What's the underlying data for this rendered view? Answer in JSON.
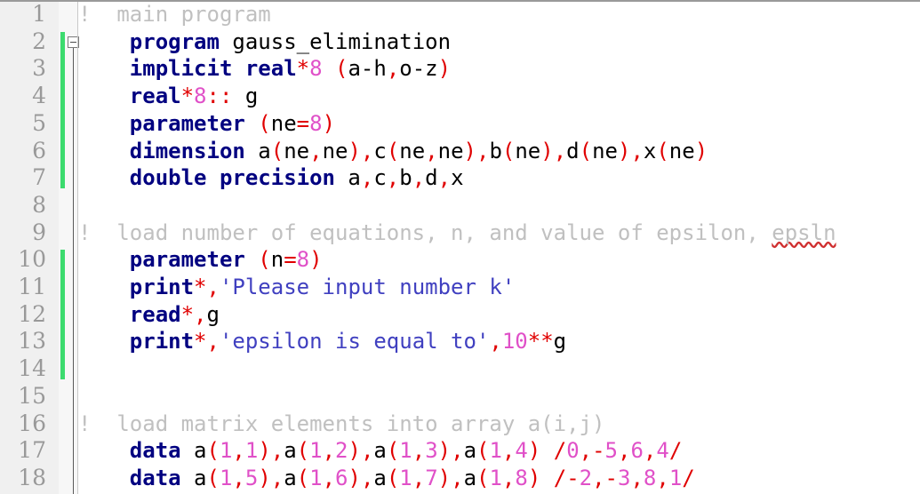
{
  "editor": {
    "language": "Fortran",
    "first_visible_line": 1,
    "last_visible_line": 18,
    "colors": {
      "background": "#ffffff",
      "gutter_background": "#f0f0f0",
      "line_number": "#999999",
      "keyword": "#000080",
      "identifier": "#000000",
      "punctuation": "#e00000",
      "number": "#e050c8",
      "string": "#4040c0",
      "comment": "#c0c0c0",
      "change_bar": "#3cdb6e",
      "spellcheck_underline": "#d03030"
    }
  },
  "gutter": {
    "fold_marker": "collapse-minus",
    "fold_marker_line": 2,
    "change_bars": [
      {
        "from_line": 2,
        "to_line": 7
      },
      {
        "from_line": 10,
        "to_line": 14
      }
    ],
    "line_numbers": [
      "1",
      "2",
      "3",
      "4",
      "5",
      "6",
      "7",
      "8",
      "9",
      "10",
      "11",
      "12",
      "13",
      "14",
      "15",
      "16",
      "17",
      "18"
    ]
  },
  "lines": [
    {
      "number": "1",
      "text": "!  main program",
      "tokens": [
        {
          "t": "!  main program",
          "c": "comment"
        }
      ]
    },
    {
      "number": "2",
      "text": "    program gauss_elimination",
      "tokens": [
        {
          "t": "    ",
          "c": "ident"
        },
        {
          "t": "program",
          "c": "kw"
        },
        {
          "t": " gauss_elimination",
          "c": "ident"
        }
      ]
    },
    {
      "number": "3",
      "text": "    implicit real*8 (a-h,o-z)",
      "tokens": [
        {
          "t": "    ",
          "c": "ident"
        },
        {
          "t": "implicit real",
          "c": "kw"
        },
        {
          "t": "*",
          "c": "punct"
        },
        {
          "t": "8",
          "c": "num"
        },
        {
          "t": " ",
          "c": "ident"
        },
        {
          "t": "(",
          "c": "punct"
        },
        {
          "t": "a-h",
          "c": "ident"
        },
        {
          "t": ",",
          "c": "punct"
        },
        {
          "t": "o-z",
          "c": "ident"
        },
        {
          "t": ")",
          "c": "punct"
        }
      ]
    },
    {
      "number": "4",
      "text": "    real*8:: g",
      "tokens": [
        {
          "t": "    ",
          "c": "ident"
        },
        {
          "t": "real",
          "c": "kw"
        },
        {
          "t": "*",
          "c": "punct"
        },
        {
          "t": "8",
          "c": "num"
        },
        {
          "t": "::",
          "c": "punct"
        },
        {
          "t": " g",
          "c": "ident"
        }
      ]
    },
    {
      "number": "5",
      "text": "    parameter (ne=8)",
      "tokens": [
        {
          "t": "    ",
          "c": "ident"
        },
        {
          "t": "parameter",
          "c": "kw"
        },
        {
          "t": " ",
          "c": "ident"
        },
        {
          "t": "(",
          "c": "punct"
        },
        {
          "t": "ne",
          "c": "ident"
        },
        {
          "t": "=",
          "c": "punct"
        },
        {
          "t": "8",
          "c": "num"
        },
        {
          "t": ")",
          "c": "punct"
        }
      ]
    },
    {
      "number": "6",
      "text": "    dimension a(ne,ne),c(ne,ne),b(ne),d(ne),x(ne)",
      "tokens": [
        {
          "t": "    ",
          "c": "ident"
        },
        {
          "t": "dimension",
          "c": "kw"
        },
        {
          "t": " a",
          "c": "ident"
        },
        {
          "t": "(",
          "c": "punct"
        },
        {
          "t": "ne",
          "c": "ident"
        },
        {
          "t": ",",
          "c": "punct"
        },
        {
          "t": "ne",
          "c": "ident"
        },
        {
          "t": ")",
          "c": "punct"
        },
        {
          "t": ",",
          "c": "punct"
        },
        {
          "t": "c",
          "c": "ident"
        },
        {
          "t": "(",
          "c": "punct"
        },
        {
          "t": "ne",
          "c": "ident"
        },
        {
          "t": ",",
          "c": "punct"
        },
        {
          "t": "ne",
          "c": "ident"
        },
        {
          "t": ")",
          "c": "punct"
        },
        {
          "t": ",",
          "c": "punct"
        },
        {
          "t": "b",
          "c": "ident"
        },
        {
          "t": "(",
          "c": "punct"
        },
        {
          "t": "ne",
          "c": "ident"
        },
        {
          "t": ")",
          "c": "punct"
        },
        {
          "t": ",",
          "c": "punct"
        },
        {
          "t": "d",
          "c": "ident"
        },
        {
          "t": "(",
          "c": "punct"
        },
        {
          "t": "ne",
          "c": "ident"
        },
        {
          "t": ")",
          "c": "punct"
        },
        {
          "t": ",",
          "c": "punct"
        },
        {
          "t": "x",
          "c": "ident"
        },
        {
          "t": "(",
          "c": "punct"
        },
        {
          "t": "ne",
          "c": "ident"
        },
        {
          "t": ")",
          "c": "punct"
        }
      ]
    },
    {
      "number": "7",
      "text": "    double precision a,c,b,d,x",
      "tokens": [
        {
          "t": "    ",
          "c": "ident"
        },
        {
          "t": "double precision",
          "c": "kw"
        },
        {
          "t": " a",
          "c": "ident"
        },
        {
          "t": ",",
          "c": "punct"
        },
        {
          "t": "c",
          "c": "ident"
        },
        {
          "t": ",",
          "c": "punct"
        },
        {
          "t": "b",
          "c": "ident"
        },
        {
          "t": ",",
          "c": "punct"
        },
        {
          "t": "d",
          "c": "ident"
        },
        {
          "t": ",",
          "c": "punct"
        },
        {
          "t": "x",
          "c": "ident"
        }
      ]
    },
    {
      "number": "8",
      "text": "",
      "tokens": []
    },
    {
      "number": "9",
      "text": "!  load number of equations, n, and value of epsilon, epsln",
      "tokens": [
        {
          "t": "!  load number of equations, n, and value of epsilon, ",
          "c": "comment"
        },
        {
          "t": "epsln",
          "c": "misspell"
        }
      ]
    },
    {
      "number": "10",
      "text": "    parameter (n=8)",
      "tokens": [
        {
          "t": "    ",
          "c": "ident"
        },
        {
          "t": "parameter",
          "c": "kw"
        },
        {
          "t": " ",
          "c": "ident"
        },
        {
          "t": "(",
          "c": "punct"
        },
        {
          "t": "n",
          "c": "ident"
        },
        {
          "t": "=",
          "c": "punct"
        },
        {
          "t": "8",
          "c": "num"
        },
        {
          "t": ")",
          "c": "punct"
        }
      ]
    },
    {
      "number": "11",
      "text": "    print*,'Please input number k'",
      "tokens": [
        {
          "t": "    ",
          "c": "ident"
        },
        {
          "t": "print",
          "c": "kw"
        },
        {
          "t": "*",
          "c": "punct"
        },
        {
          "t": ",",
          "c": "punct"
        },
        {
          "t": "'Please input number k'",
          "c": "str"
        }
      ]
    },
    {
      "number": "12",
      "text": "    read*,g",
      "tokens": [
        {
          "t": "    ",
          "c": "ident"
        },
        {
          "t": "read",
          "c": "kw"
        },
        {
          "t": "*",
          "c": "punct"
        },
        {
          "t": ",",
          "c": "punct"
        },
        {
          "t": "g",
          "c": "ident"
        }
      ]
    },
    {
      "number": "13",
      "text": "    print*,'epsilon is equal to',10**g",
      "tokens": [
        {
          "t": "    ",
          "c": "ident"
        },
        {
          "t": "print",
          "c": "kw"
        },
        {
          "t": "*",
          "c": "punct"
        },
        {
          "t": ",",
          "c": "punct"
        },
        {
          "t": "'epsilon is equal to'",
          "c": "str"
        },
        {
          "t": ",",
          "c": "punct"
        },
        {
          "t": "10",
          "c": "num"
        },
        {
          "t": "**",
          "c": "punct"
        },
        {
          "t": "g",
          "c": "ident"
        }
      ]
    },
    {
      "number": "14",
      "text": "",
      "tokens": []
    },
    {
      "number": "15",
      "text": "",
      "tokens": []
    },
    {
      "number": "16",
      "text": "!  load matrix elements into array a(i,j)",
      "tokens": [
        {
          "t": "!  load matrix elements into array a(i,j)",
          "c": "comment"
        }
      ]
    },
    {
      "number": "17",
      "text": "    data a(1,1),a(1,2),a(1,3),a(1,4) /0,-5,6,4/",
      "tokens": [
        {
          "t": "    ",
          "c": "ident"
        },
        {
          "t": "data",
          "c": "kw"
        },
        {
          "t": " a",
          "c": "ident"
        },
        {
          "t": "(",
          "c": "punct"
        },
        {
          "t": "1",
          "c": "num"
        },
        {
          "t": ",",
          "c": "punct"
        },
        {
          "t": "1",
          "c": "num"
        },
        {
          "t": ")",
          "c": "punct"
        },
        {
          "t": ",",
          "c": "punct"
        },
        {
          "t": "a",
          "c": "ident"
        },
        {
          "t": "(",
          "c": "punct"
        },
        {
          "t": "1",
          "c": "num"
        },
        {
          "t": ",",
          "c": "punct"
        },
        {
          "t": "2",
          "c": "num"
        },
        {
          "t": ")",
          "c": "punct"
        },
        {
          "t": ",",
          "c": "punct"
        },
        {
          "t": "a",
          "c": "ident"
        },
        {
          "t": "(",
          "c": "punct"
        },
        {
          "t": "1",
          "c": "num"
        },
        {
          "t": ",",
          "c": "punct"
        },
        {
          "t": "3",
          "c": "num"
        },
        {
          "t": ")",
          "c": "punct"
        },
        {
          "t": ",",
          "c": "punct"
        },
        {
          "t": "a",
          "c": "ident"
        },
        {
          "t": "(",
          "c": "punct"
        },
        {
          "t": "1",
          "c": "num"
        },
        {
          "t": ",",
          "c": "punct"
        },
        {
          "t": "4",
          "c": "num"
        },
        {
          "t": ")",
          "c": "punct"
        },
        {
          "t": " ",
          "c": "ident"
        },
        {
          "t": "/",
          "c": "punct"
        },
        {
          "t": "0",
          "c": "num"
        },
        {
          "t": ",",
          "c": "punct"
        },
        {
          "t": "-",
          "c": "punct"
        },
        {
          "t": "5",
          "c": "num"
        },
        {
          "t": ",",
          "c": "punct"
        },
        {
          "t": "6",
          "c": "num"
        },
        {
          "t": ",",
          "c": "punct"
        },
        {
          "t": "4",
          "c": "num"
        },
        {
          "t": "/",
          "c": "punct"
        }
      ]
    },
    {
      "number": "18",
      "text": "    data a(1,5),a(1,6),a(1,7),a(1,8) /-2,-3,8,1/",
      "tokens": [
        {
          "t": "    ",
          "c": "ident"
        },
        {
          "t": "data",
          "c": "kw"
        },
        {
          "t": " a",
          "c": "ident"
        },
        {
          "t": "(",
          "c": "punct"
        },
        {
          "t": "1",
          "c": "num"
        },
        {
          "t": ",",
          "c": "punct"
        },
        {
          "t": "5",
          "c": "num"
        },
        {
          "t": ")",
          "c": "punct"
        },
        {
          "t": ",",
          "c": "punct"
        },
        {
          "t": "a",
          "c": "ident"
        },
        {
          "t": "(",
          "c": "punct"
        },
        {
          "t": "1",
          "c": "num"
        },
        {
          "t": ",",
          "c": "punct"
        },
        {
          "t": "6",
          "c": "num"
        },
        {
          "t": ")",
          "c": "punct"
        },
        {
          "t": ",",
          "c": "punct"
        },
        {
          "t": "a",
          "c": "ident"
        },
        {
          "t": "(",
          "c": "punct"
        },
        {
          "t": "1",
          "c": "num"
        },
        {
          "t": ",",
          "c": "punct"
        },
        {
          "t": "7",
          "c": "num"
        },
        {
          "t": ")",
          "c": "punct"
        },
        {
          "t": ",",
          "c": "punct"
        },
        {
          "t": "a",
          "c": "ident"
        },
        {
          "t": "(",
          "c": "punct"
        },
        {
          "t": "1",
          "c": "num"
        },
        {
          "t": ",",
          "c": "punct"
        },
        {
          "t": "8",
          "c": "num"
        },
        {
          "t": ")",
          "c": "punct"
        },
        {
          "t": " ",
          "c": "ident"
        },
        {
          "t": "/",
          "c": "punct"
        },
        {
          "t": "-",
          "c": "punct"
        },
        {
          "t": "2",
          "c": "num"
        },
        {
          "t": ",",
          "c": "punct"
        },
        {
          "t": "-",
          "c": "punct"
        },
        {
          "t": "3",
          "c": "num"
        },
        {
          "t": ",",
          "c": "punct"
        },
        {
          "t": "8",
          "c": "num"
        },
        {
          "t": ",",
          "c": "punct"
        },
        {
          "t": "1",
          "c": "num"
        },
        {
          "t": "/",
          "c": "punct"
        }
      ]
    }
  ]
}
